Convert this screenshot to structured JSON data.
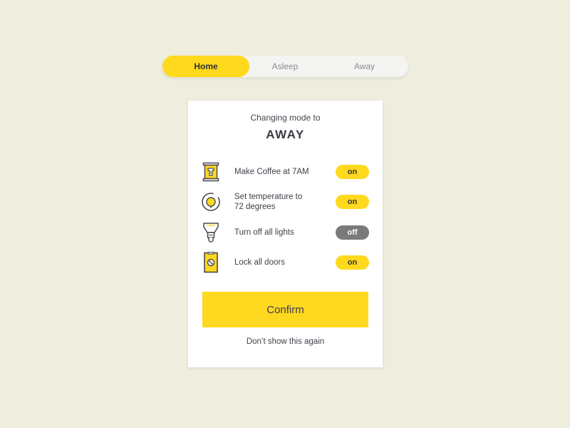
{
  "modes": {
    "items": [
      {
        "label": "Home",
        "active": true
      },
      {
        "label": "Asleep",
        "active": false
      },
      {
        "label": "Away",
        "active": false
      }
    ]
  },
  "dialog": {
    "subtitle": "Changing mode to",
    "title": "AWAY",
    "actions": [
      {
        "icon": "coffee-maker-icon",
        "label": "Make Coffee at 7AM",
        "state": "on"
      },
      {
        "icon": "thermostat-icon",
        "label_line1": "Set temperature to",
        "label_line2": "72 degrees",
        "state": "on"
      },
      {
        "icon": "light-bulb-icon",
        "label": "Turn off all lights",
        "state": "off"
      },
      {
        "icon": "door-lock-icon",
        "label": "Lock all doors",
        "state": "on"
      }
    ],
    "confirm_label": "Confirm",
    "dismiss_label": "Don’t show this again"
  },
  "colors": {
    "accent": "#ffd91e",
    "background": "#efedde",
    "toggle_off": "#7a7a7a"
  }
}
